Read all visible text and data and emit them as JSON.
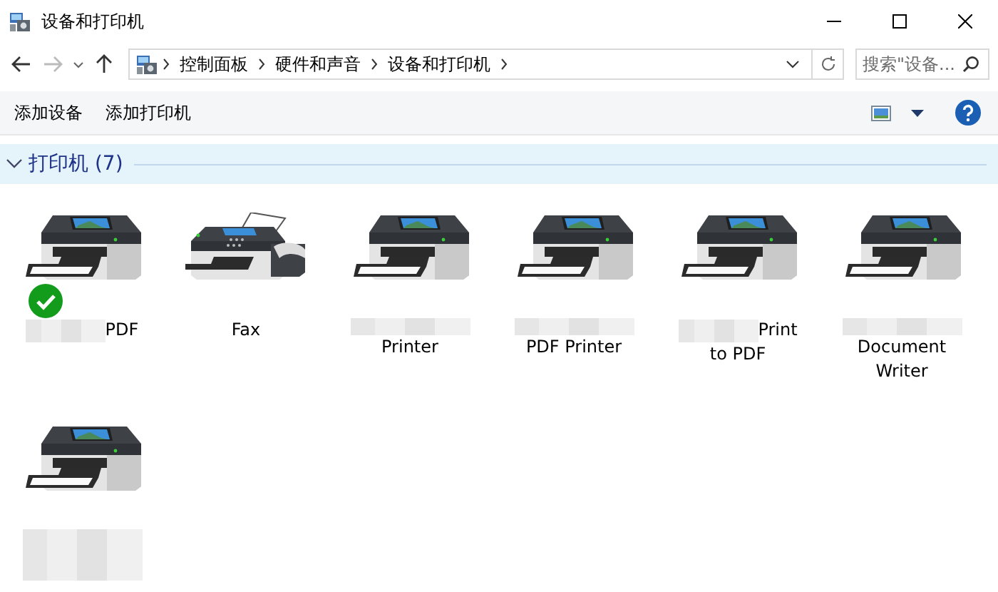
{
  "window": {
    "title": "设备和打印机"
  },
  "address_bar": {
    "crumbs": [
      "控制面板",
      "硬件和声音",
      "设备和打印机"
    ]
  },
  "search": {
    "placeholder": "搜索\"设备..."
  },
  "toolbar": {
    "buttons": [
      "添加设备",
      "添加打印机"
    ]
  },
  "group": {
    "title": "打印机 (7)",
    "expanded": true
  },
  "devices": [
    {
      "kind": "printer",
      "default": true,
      "lines": [
        [
          {
            "kind": "redacted"
          },
          {
            "kind": "text",
            "text": "PDF"
          }
        ]
      ]
    },
    {
      "kind": "fax",
      "default": false,
      "lines": [
        [
          {
            "kind": "text",
            "text": "Fax"
          }
        ]
      ]
    },
    {
      "kind": "printer",
      "default": false,
      "lines": [
        [
          {
            "kind": "redacted"
          }
        ],
        [
          {
            "kind": "text",
            "text": "Printer"
          }
        ]
      ]
    },
    {
      "kind": "printer",
      "default": false,
      "lines": [
        [
          {
            "kind": "redacted"
          }
        ],
        [
          {
            "kind": "text",
            "text": "PDF Printer"
          }
        ]
      ]
    },
    {
      "kind": "printer",
      "default": false,
      "lines": [
        [
          {
            "kind": "redacted"
          },
          {
            "kind": "text",
            "text": "Print"
          }
        ],
        [
          {
            "kind": "text",
            "text": "to PDF"
          }
        ]
      ]
    },
    {
      "kind": "printer",
      "default": false,
      "lines": [
        [
          {
            "kind": "redacted"
          }
        ],
        [
          {
            "kind": "text",
            "text": "Document"
          }
        ],
        [
          {
            "kind": "text",
            "text": "Writer"
          }
        ]
      ]
    },
    {
      "kind": "printer",
      "default": false,
      "lines": [
        [
          {
            "kind": "redacted"
          }
        ],
        [
          {
            "kind": "redacted"
          }
        ],
        [
          {
            "kind": "redacted"
          }
        ]
      ]
    }
  ]
}
